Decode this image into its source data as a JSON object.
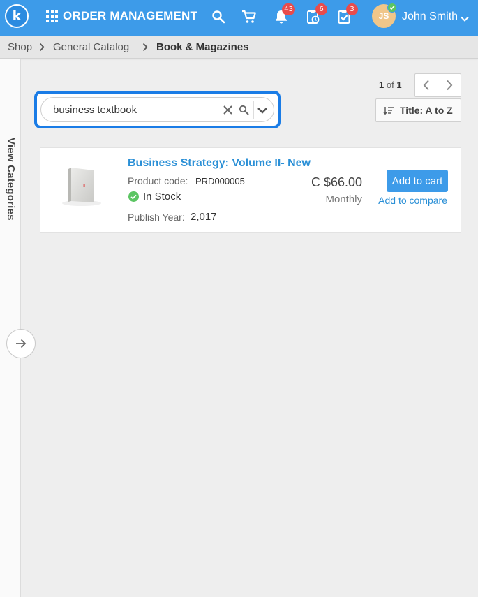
{
  "header": {
    "logo_letter": "k",
    "app_title": "ORDER MANAGEMENT",
    "notifications_count": "43",
    "orders_count": "6",
    "tasks_count": "3",
    "user_initials": "JS",
    "user_name": "John Smith"
  },
  "breadcrumb": [
    "Shop",
    "General Catalog",
    "Book & Magazines"
  ],
  "sidebar": {
    "label": "View Categories"
  },
  "pagination": {
    "current": "1",
    "of": "of",
    "total": "1"
  },
  "sort": {
    "label": "Title: A to Z"
  },
  "search": {
    "value": "business textbook"
  },
  "product": {
    "title": "Business Strategy: Volume II- New",
    "code_label": "Product code:",
    "code": "PRD000005",
    "stock": "In Stock",
    "year_label": "Publish Year:",
    "year": "2,017",
    "price": "C $66.00",
    "period": "Monthly",
    "add_to_cart": "Add to cart",
    "add_to_compare": "Add to compare",
    "book_spine_mark": "II"
  },
  "colors": {
    "header": "#3d9be9",
    "accent": "#2a8fd6",
    "search_highlight": "#1a7ce6",
    "badge": "#e84c4c",
    "in_stock": "#5cc563"
  }
}
